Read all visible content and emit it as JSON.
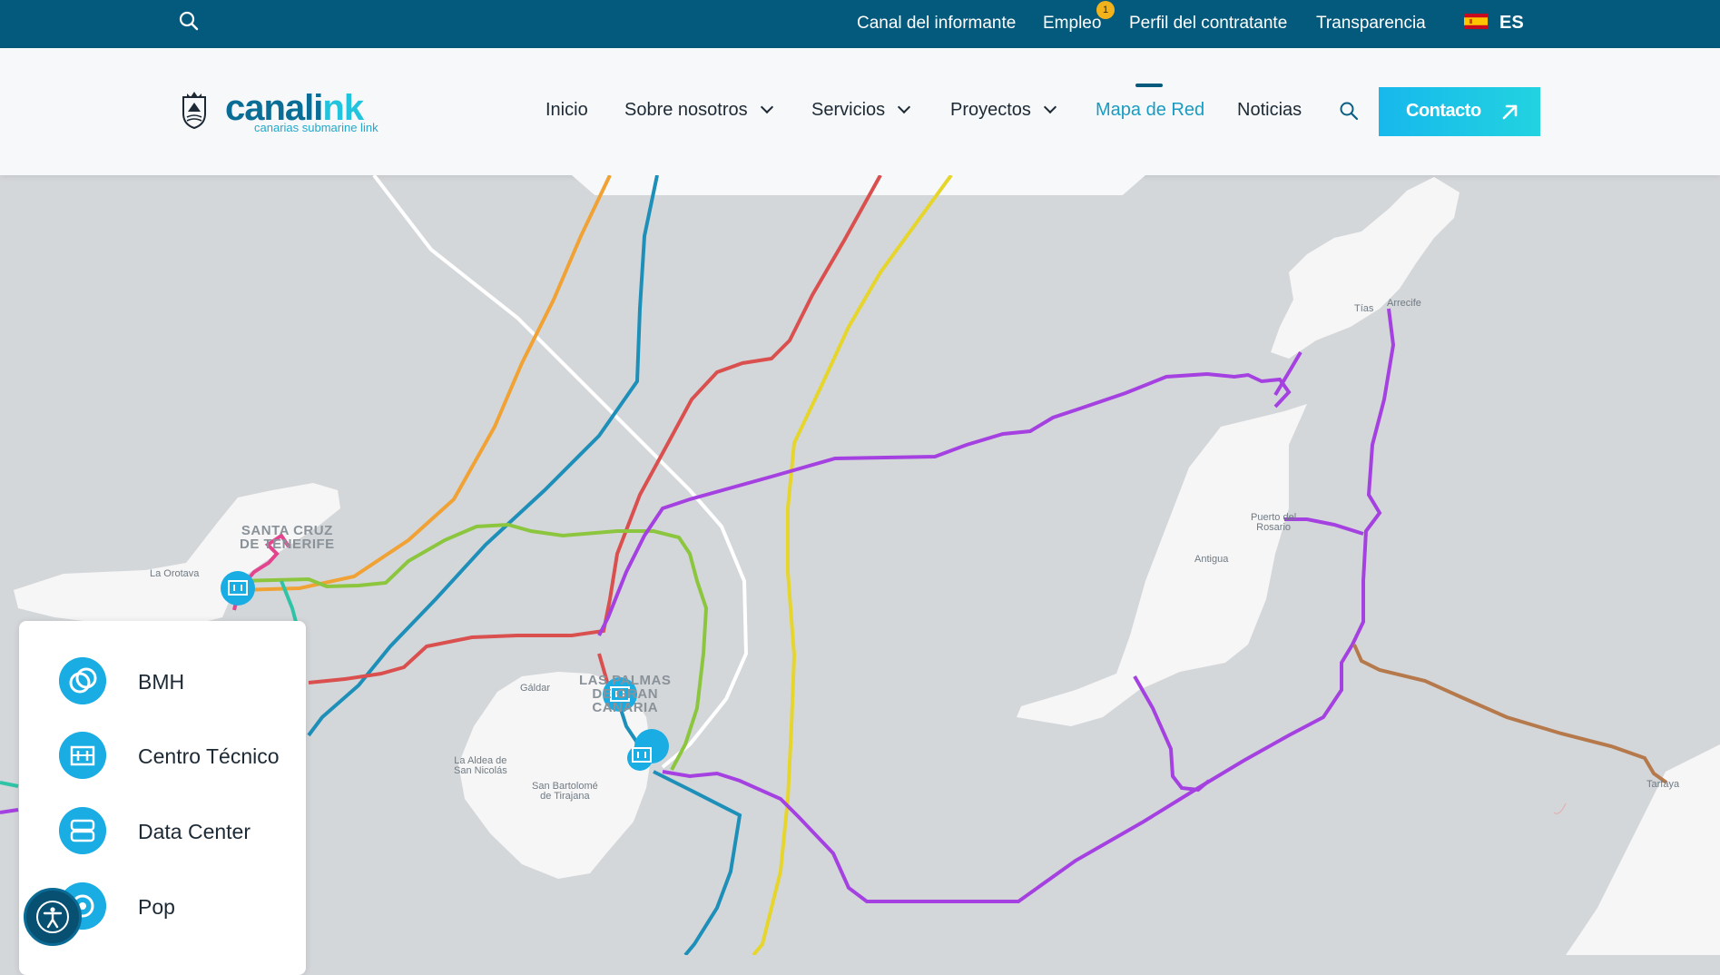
{
  "topbar": {
    "links": [
      {
        "label": "Canal del informante"
      },
      {
        "label": "Empleo",
        "badge": "1"
      },
      {
        "label": "Perfil del contratante"
      },
      {
        "label": "Transparencia"
      }
    ],
    "language": "ES",
    "search_icon": "search-icon",
    "flag_icon": "spain-flag-icon"
  },
  "logo": {
    "name": "canalink",
    "name_main": "canali",
    "name_accent": "nk",
    "tagline": "canarias submarine link",
    "emblem_icon": "cabildo-de-tenerife-shield-icon"
  },
  "nav": {
    "items": [
      {
        "label": "Inicio",
        "dropdown": false
      },
      {
        "label": "Sobre nosotros",
        "dropdown": true
      },
      {
        "label": "Servicios",
        "dropdown": true
      },
      {
        "label": "Proyectos",
        "dropdown": true
      },
      {
        "label": "Mapa de Red",
        "dropdown": false,
        "active": true
      },
      {
        "label": "Noticias",
        "dropdown": false
      }
    ],
    "search_icon": "search-icon",
    "cta": {
      "label": "Contacto",
      "icon": "arrow-up-right-icon"
    }
  },
  "map": {
    "places": {
      "santa_cruz_1": "SANTA CRUZ",
      "santa_cruz_2": "DE TENERIFE",
      "la_orotava": "La Orotava",
      "las_palmas_1": "LAS PALMAS",
      "las_palmas_2": "DE GRAN",
      "las_palmas_3": "CANARIA",
      "galdar": "Gáldar",
      "la_aldea_1": "La Aldea de",
      "la_aldea_2": "San Nicolás",
      "san_bartolome_1": "San Bartolomé",
      "san_bartolome_2": "de Tirajana",
      "tias": "Tías",
      "arrecife": "Arrecife",
      "puerto_rosario_1": "Puerto del",
      "puerto_rosario_2": "Rosario",
      "antigua": "Antigua",
      "tarfaya": "Tarfaya"
    },
    "cable_colors": {
      "white": "#ffffff",
      "orange": "#f0a235",
      "blue": "#1d8fb8",
      "red": "#d9504f",
      "yellow": "#e6d52a",
      "green": "#8cc63f",
      "purple": "#a441e0",
      "brown": "#b5794b",
      "pink": "#e3448d",
      "teal": "#2fc4a7"
    },
    "marker_icon": "building-icon"
  },
  "legend": {
    "items": [
      {
        "label": "BMH",
        "icon": "bmh-circles-icon"
      },
      {
        "label": "Centro Técnico",
        "icon": "building-icon"
      },
      {
        "label": "Data Center",
        "icon": "server-icon"
      },
      {
        "label": "Pop",
        "icon": "pop-target-icon"
      }
    ]
  },
  "accessibility_icon": "accessibility-icon"
}
